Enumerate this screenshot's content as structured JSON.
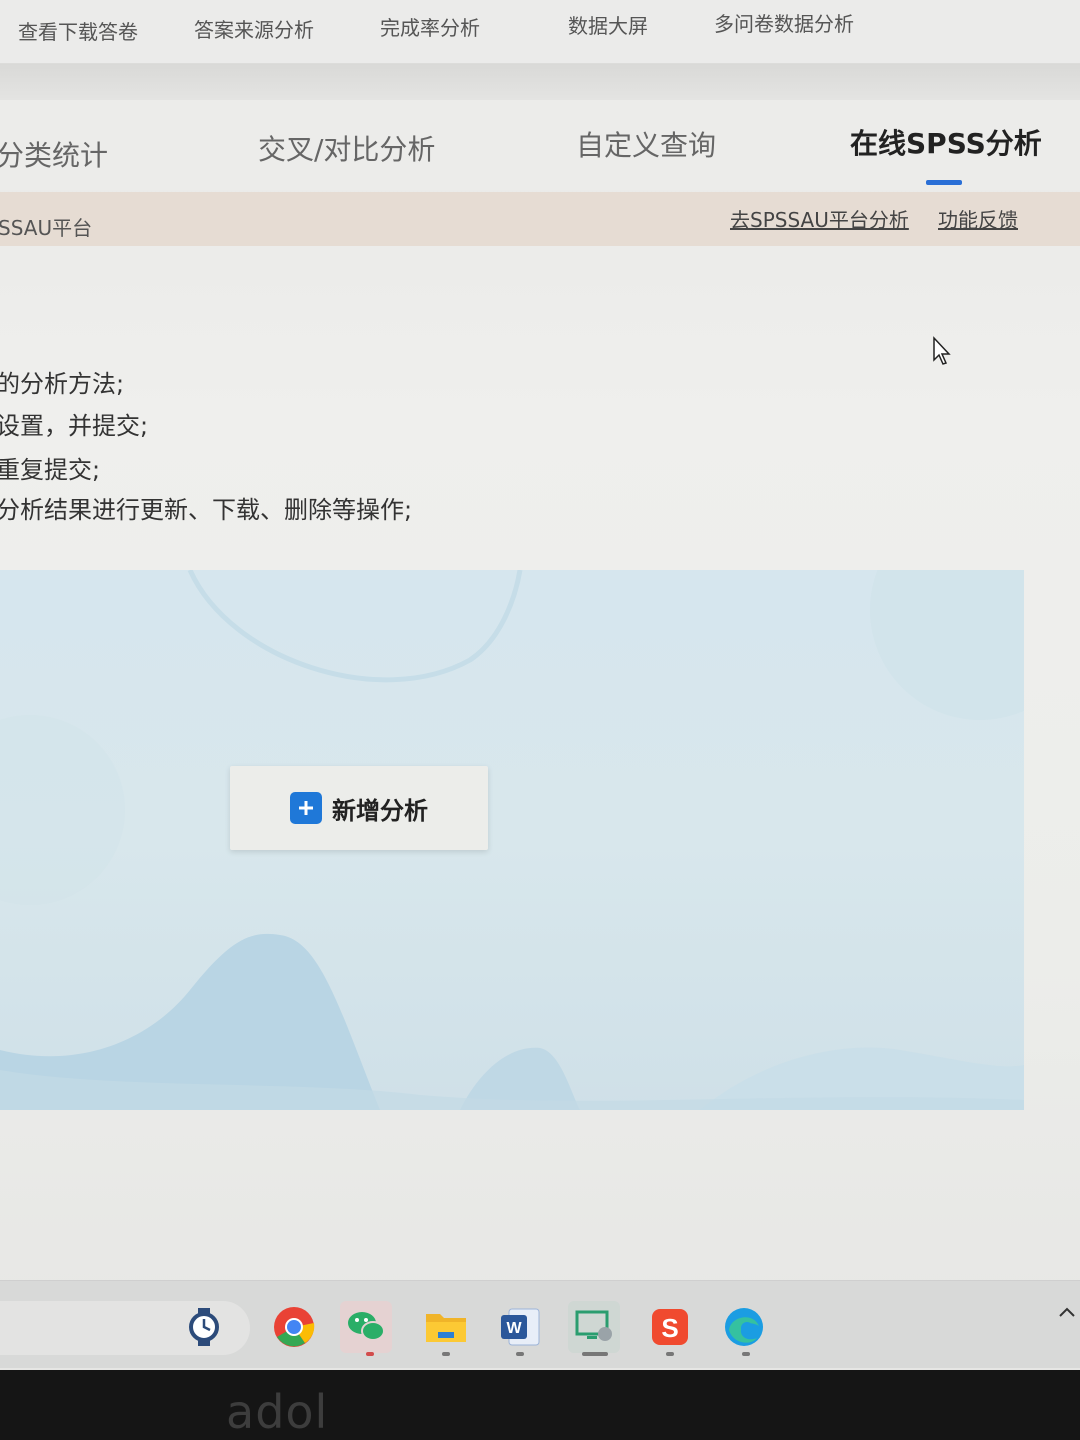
{
  "top_nav": [
    "查看下载答卷",
    "答案来源分析",
    "完成率分析",
    "数据大屏",
    "多问卷数据分析"
  ],
  "sub_tabs": [
    "分类统计",
    "交叉/对比分析",
    "自定义查询",
    "在线SPSS分析"
  ],
  "active_tab": "在线SPSS分析",
  "notice": {
    "left_text": "SSAU平台",
    "link_go": "去SPSSAU平台分析",
    "link_feedback": "功能反馈"
  },
  "instructions": [
    "的分析方法;",
    "设置，并提交;",
    "重复提交;",
    "分析结果进行更新、下载、删除等操作;"
  ],
  "panel": {
    "add_button_label": "新增分析"
  },
  "taskbar": {
    "apps": [
      "clock-icon",
      "chrome-icon",
      "wechat-icon",
      "file-explorer-icon",
      "word-icon",
      "remote-desktop-icon",
      "sogou-icon",
      "edge-icon"
    ]
  },
  "brand": "adol",
  "colors": {
    "accent": "#2a6fd6",
    "plus_button": "#1f78d8",
    "notice_bg": "#e6dcd3",
    "panel_bg": "#d6e6ee"
  }
}
